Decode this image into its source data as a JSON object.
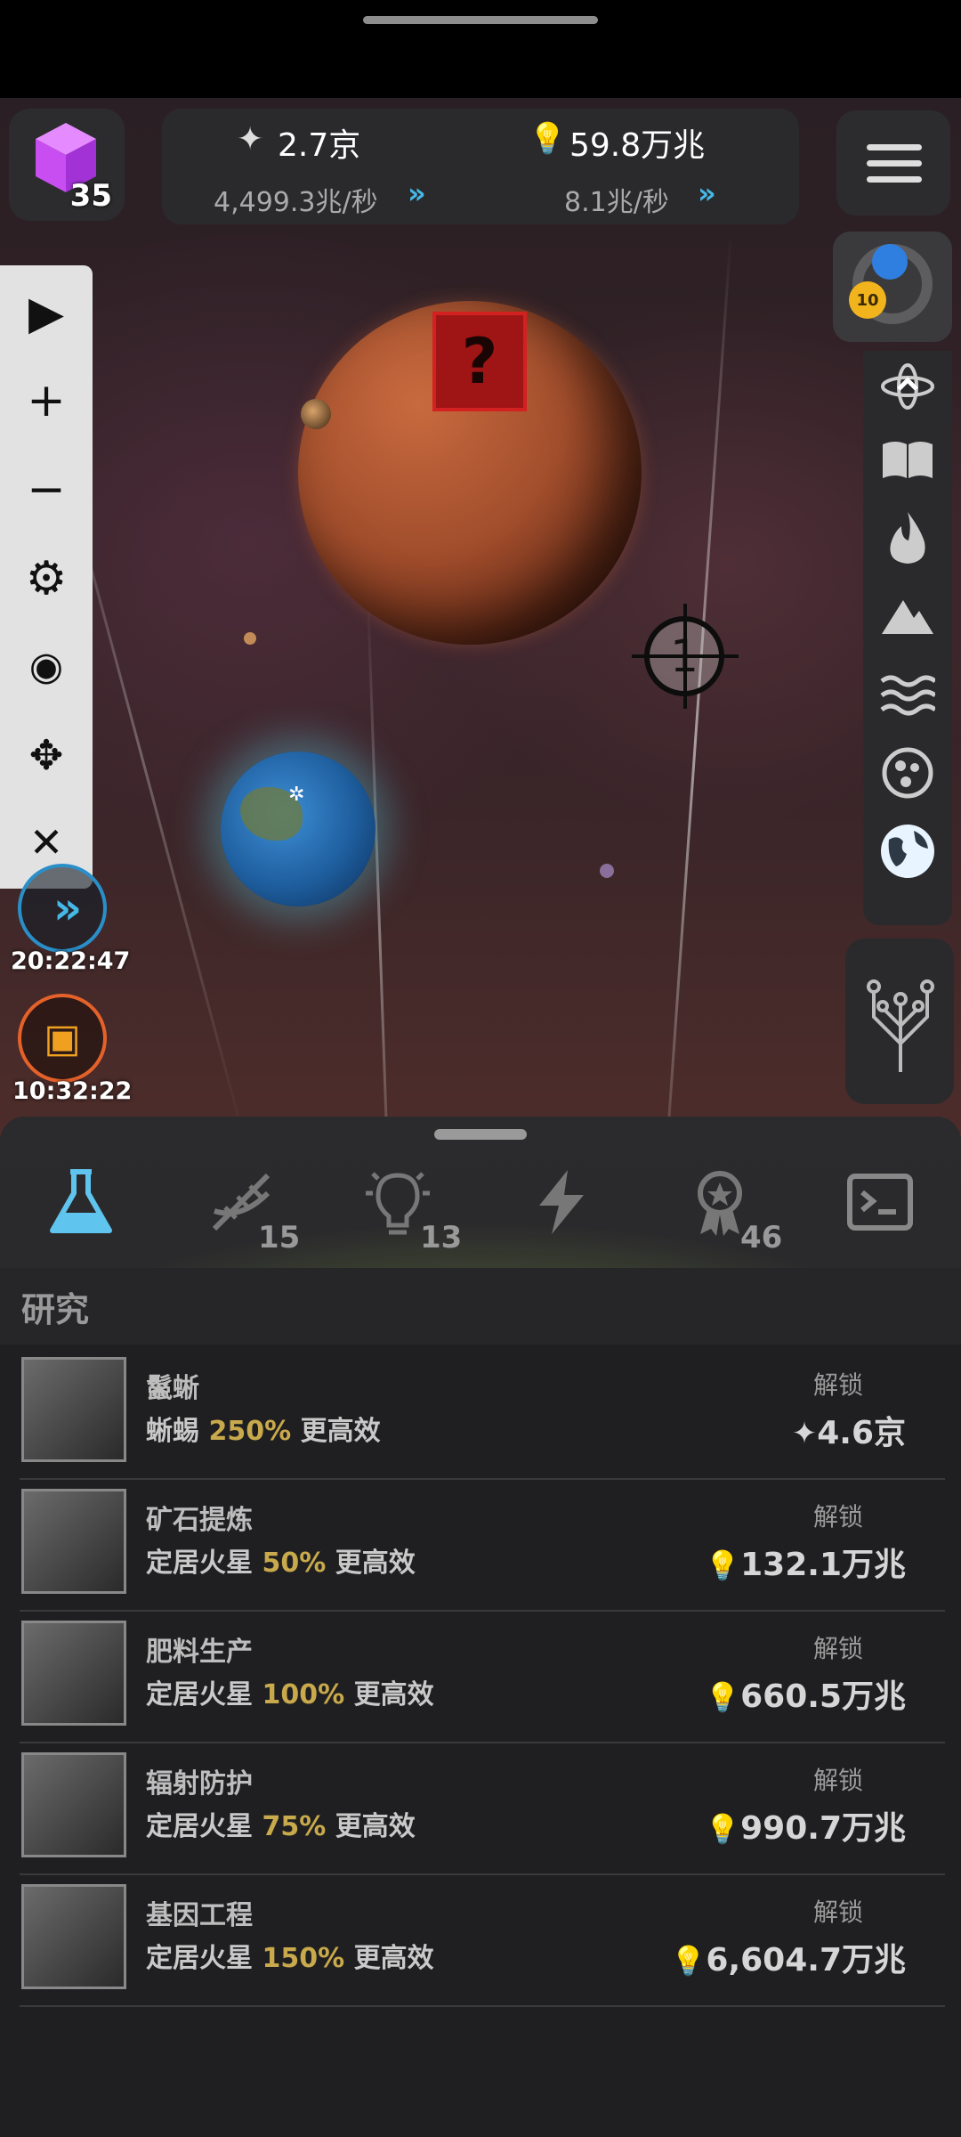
{
  "resources": {
    "dark_matter": "2.7京",
    "dark_matter_rate": "4,499.3兆/秒",
    "ideas": "59.8万兆",
    "ideas_rate": "8.1兆/秒"
  },
  "cube": {
    "count": "35"
  },
  "right_dial": {
    "badge": "10"
  },
  "crosshair": {
    "label": "1"
  },
  "mystery_box": {
    "label": "?"
  },
  "timers": {
    "boost": "20:22:47",
    "calendar": "10:32:22"
  },
  "tabs": [
    {
      "name": "research",
      "count": ""
    },
    {
      "name": "genetics",
      "count": "15"
    },
    {
      "name": "ideas",
      "count": "13"
    },
    {
      "name": "power",
      "count": ""
    },
    {
      "name": "achievements",
      "count": "46"
    },
    {
      "name": "terminal",
      "count": ""
    }
  ],
  "section_title": "研究",
  "research": [
    {
      "name": "鬣蜥",
      "target": "蜥蜴",
      "pct": "250%",
      "suffix": "更高效",
      "unlock": "解锁",
      "cost_icon": "dark-matter",
      "cost": "4.6京"
    },
    {
      "name": "矿石提炼",
      "target": "定居火星",
      "pct": "50%",
      "suffix": "更高效",
      "unlock": "解锁",
      "cost_icon": "idea",
      "cost": "132.1万兆"
    },
    {
      "name": "肥料生产",
      "target": "定居火星",
      "pct": "100%",
      "suffix": "更高效",
      "unlock": "解锁",
      "cost_icon": "idea",
      "cost": "660.5万兆"
    },
    {
      "name": "辐射防护",
      "target": "定居火星",
      "pct": "75%",
      "suffix": "更高效",
      "unlock": "解锁",
      "cost_icon": "idea",
      "cost": "990.7万兆"
    },
    {
      "name": "基因工程",
      "target": "定居火星",
      "pct": "150%",
      "suffix": "更高效",
      "unlock": "解锁",
      "cost_icon": "idea",
      "cost": "6,604.7万兆"
    }
  ],
  "colors": {
    "accent_blue": "#46b8e6",
    "percent_gold": "#c8a94b",
    "cube_purple": "#c94ef2"
  }
}
